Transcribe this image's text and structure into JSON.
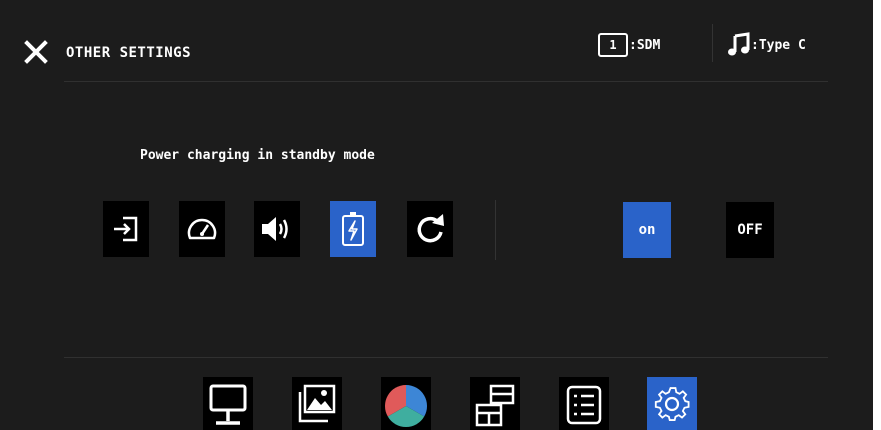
{
  "header": {
    "title": "OTHER SETTINGS",
    "close_icon": "close-icon",
    "input_source": {
      "number": "1",
      "label": ":SDM",
      "icon": "input-number-icon"
    },
    "audio_source": {
      "label": ":Type C",
      "icon": "music-note-icon"
    }
  },
  "setting": {
    "label": "Power charging in standby mode",
    "options": [
      {
        "icon": "input-source-icon",
        "selected": false
      },
      {
        "icon": "speedometer-icon",
        "selected": false
      },
      {
        "icon": "speaker-volume-icon",
        "selected": false
      },
      {
        "icon": "battery-charging-icon",
        "selected": true
      },
      {
        "icon": "reset-icon",
        "selected": false
      }
    ],
    "toggle": {
      "on_label": "on",
      "off_label": "OFF",
      "value": "on"
    }
  },
  "bottom_nav": [
    {
      "icon": "monitor-icon",
      "active": false
    },
    {
      "icon": "picture-icon",
      "active": false
    },
    {
      "icon": "color-wheel-icon",
      "active": false
    },
    {
      "icon": "multi-window-icon",
      "active": false
    },
    {
      "icon": "menu-list-icon",
      "active": false
    },
    {
      "icon": "gear-icon",
      "active": true
    }
  ],
  "colors": {
    "background": "#1c1c1c",
    "accent": "#2a63c9",
    "tile": "#000000"
  }
}
